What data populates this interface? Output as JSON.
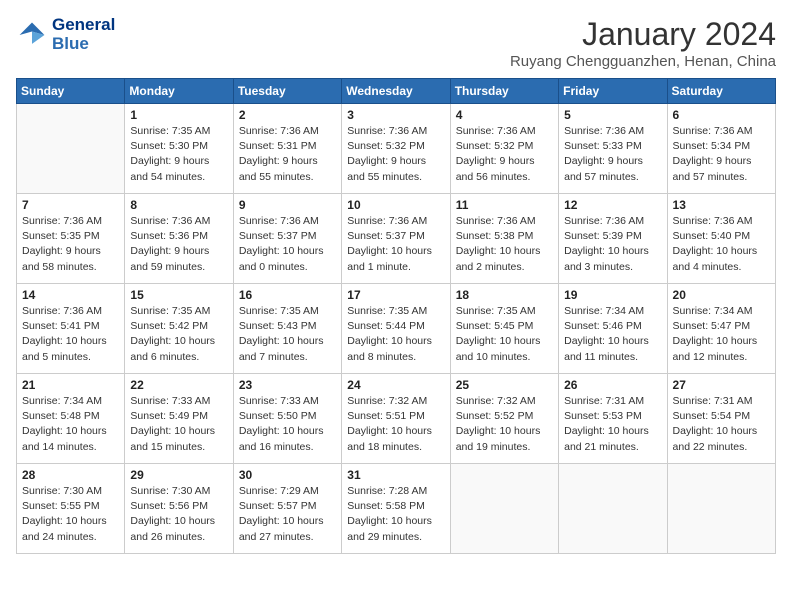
{
  "logo": {
    "line1": "General",
    "line2": "Blue"
  },
  "title": "January 2024",
  "subtitle": "Ruyang Chengguanzhen, Henan, China",
  "days_of_week": [
    "Sunday",
    "Monday",
    "Tuesday",
    "Wednesday",
    "Thursday",
    "Friday",
    "Saturday"
  ],
  "weeks": [
    [
      {
        "day": "",
        "info": ""
      },
      {
        "day": "1",
        "info": "Sunrise: 7:35 AM\nSunset: 5:30 PM\nDaylight: 9 hours\nand 54 minutes."
      },
      {
        "day": "2",
        "info": "Sunrise: 7:36 AM\nSunset: 5:31 PM\nDaylight: 9 hours\nand 55 minutes."
      },
      {
        "day": "3",
        "info": "Sunrise: 7:36 AM\nSunset: 5:32 PM\nDaylight: 9 hours\nand 55 minutes."
      },
      {
        "day": "4",
        "info": "Sunrise: 7:36 AM\nSunset: 5:32 PM\nDaylight: 9 hours\nand 56 minutes."
      },
      {
        "day": "5",
        "info": "Sunrise: 7:36 AM\nSunset: 5:33 PM\nDaylight: 9 hours\nand 57 minutes."
      },
      {
        "day": "6",
        "info": "Sunrise: 7:36 AM\nSunset: 5:34 PM\nDaylight: 9 hours\nand 57 minutes."
      }
    ],
    [
      {
        "day": "7",
        "info": "Sunrise: 7:36 AM\nSunset: 5:35 PM\nDaylight: 9 hours\nand 58 minutes."
      },
      {
        "day": "8",
        "info": "Sunrise: 7:36 AM\nSunset: 5:36 PM\nDaylight: 9 hours\nand 59 minutes."
      },
      {
        "day": "9",
        "info": "Sunrise: 7:36 AM\nSunset: 5:37 PM\nDaylight: 10 hours\nand 0 minutes."
      },
      {
        "day": "10",
        "info": "Sunrise: 7:36 AM\nSunset: 5:37 PM\nDaylight: 10 hours\nand 1 minute."
      },
      {
        "day": "11",
        "info": "Sunrise: 7:36 AM\nSunset: 5:38 PM\nDaylight: 10 hours\nand 2 minutes."
      },
      {
        "day": "12",
        "info": "Sunrise: 7:36 AM\nSunset: 5:39 PM\nDaylight: 10 hours\nand 3 minutes."
      },
      {
        "day": "13",
        "info": "Sunrise: 7:36 AM\nSunset: 5:40 PM\nDaylight: 10 hours\nand 4 minutes."
      }
    ],
    [
      {
        "day": "14",
        "info": "Sunrise: 7:36 AM\nSunset: 5:41 PM\nDaylight: 10 hours\nand 5 minutes."
      },
      {
        "day": "15",
        "info": "Sunrise: 7:35 AM\nSunset: 5:42 PM\nDaylight: 10 hours\nand 6 minutes."
      },
      {
        "day": "16",
        "info": "Sunrise: 7:35 AM\nSunset: 5:43 PM\nDaylight: 10 hours\nand 7 minutes."
      },
      {
        "day": "17",
        "info": "Sunrise: 7:35 AM\nSunset: 5:44 PM\nDaylight: 10 hours\nand 8 minutes."
      },
      {
        "day": "18",
        "info": "Sunrise: 7:35 AM\nSunset: 5:45 PM\nDaylight: 10 hours\nand 10 minutes."
      },
      {
        "day": "19",
        "info": "Sunrise: 7:34 AM\nSunset: 5:46 PM\nDaylight: 10 hours\nand 11 minutes."
      },
      {
        "day": "20",
        "info": "Sunrise: 7:34 AM\nSunset: 5:47 PM\nDaylight: 10 hours\nand 12 minutes."
      }
    ],
    [
      {
        "day": "21",
        "info": "Sunrise: 7:34 AM\nSunset: 5:48 PM\nDaylight: 10 hours\nand 14 minutes."
      },
      {
        "day": "22",
        "info": "Sunrise: 7:33 AM\nSunset: 5:49 PM\nDaylight: 10 hours\nand 15 minutes."
      },
      {
        "day": "23",
        "info": "Sunrise: 7:33 AM\nSunset: 5:50 PM\nDaylight: 10 hours\nand 16 minutes."
      },
      {
        "day": "24",
        "info": "Sunrise: 7:32 AM\nSunset: 5:51 PM\nDaylight: 10 hours\nand 18 minutes."
      },
      {
        "day": "25",
        "info": "Sunrise: 7:32 AM\nSunset: 5:52 PM\nDaylight: 10 hours\nand 19 minutes."
      },
      {
        "day": "26",
        "info": "Sunrise: 7:31 AM\nSunset: 5:53 PM\nDaylight: 10 hours\nand 21 minutes."
      },
      {
        "day": "27",
        "info": "Sunrise: 7:31 AM\nSunset: 5:54 PM\nDaylight: 10 hours\nand 22 minutes."
      }
    ],
    [
      {
        "day": "28",
        "info": "Sunrise: 7:30 AM\nSunset: 5:55 PM\nDaylight: 10 hours\nand 24 minutes."
      },
      {
        "day": "29",
        "info": "Sunrise: 7:30 AM\nSunset: 5:56 PM\nDaylight: 10 hours\nand 26 minutes."
      },
      {
        "day": "30",
        "info": "Sunrise: 7:29 AM\nSunset: 5:57 PM\nDaylight: 10 hours\nand 27 minutes."
      },
      {
        "day": "31",
        "info": "Sunrise: 7:28 AM\nSunset: 5:58 PM\nDaylight: 10 hours\nand 29 minutes."
      },
      {
        "day": "",
        "info": ""
      },
      {
        "day": "",
        "info": ""
      },
      {
        "day": "",
        "info": ""
      }
    ]
  ]
}
